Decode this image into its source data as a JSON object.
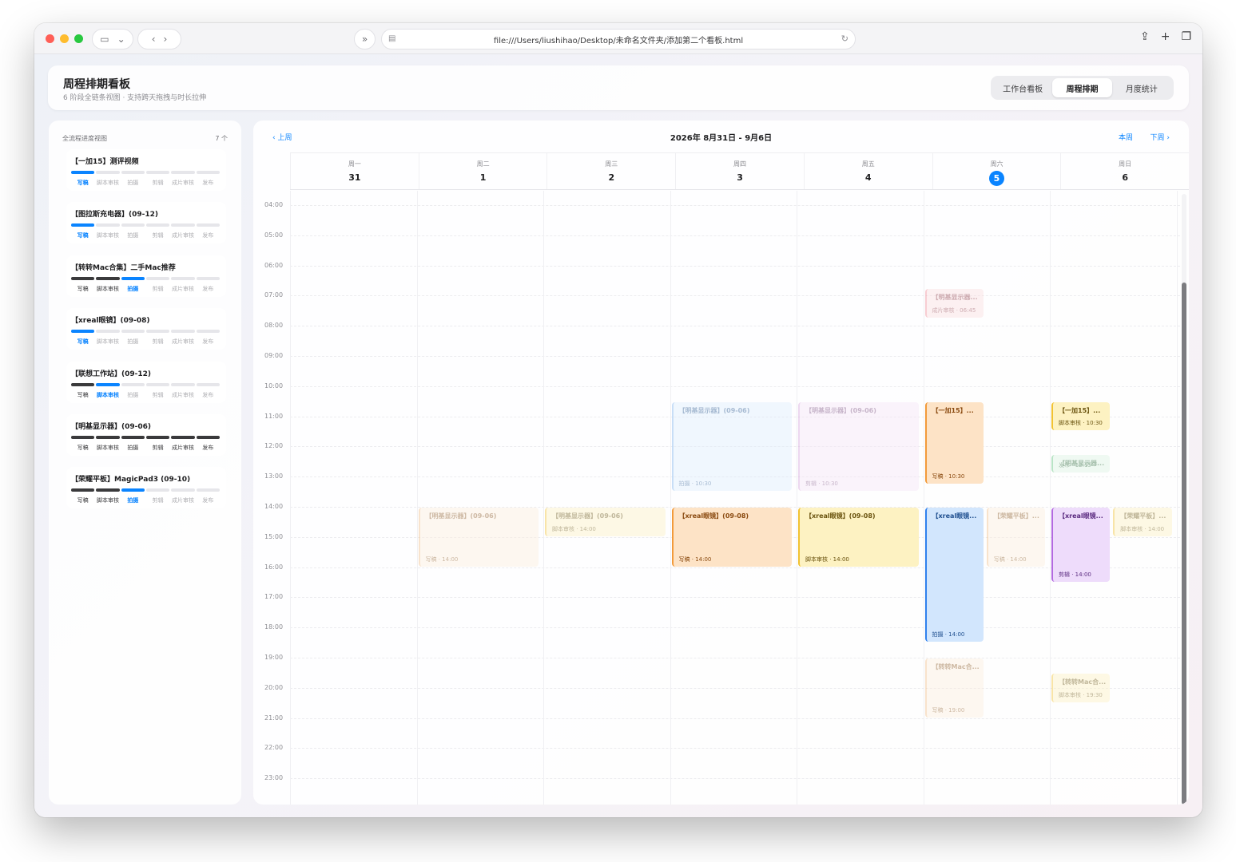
{
  "browser": {
    "url": "file:///Users/liushihao/Desktop/未命名文件夹/添加第二个看板.html",
    "icons": [
      "sidebar-toggle-icon",
      "chevron-down-icon",
      "back-icon",
      "forward-icon",
      "reader-icon",
      "page-icon",
      "reload-icon",
      "share-icon",
      "new-tab-icon",
      "tabs-overview-icon"
    ]
  },
  "header": {
    "title": "周程排期看板",
    "subtitle": "6 阶段全链条视图 · 支持跨天拖拽与时长拉伸",
    "tabs": [
      {
        "label": "工作台看板",
        "active": false
      },
      {
        "label": "周程排期",
        "active": true
      },
      {
        "label": "月度统计",
        "active": false
      }
    ]
  },
  "sidebar": {
    "title": "全流程进度视图",
    "count": "7 个",
    "stages": [
      "写稿",
      "脚本审核",
      "拍摄",
      "剪辑",
      "成片审核",
      "发布"
    ],
    "projects": [
      {
        "title": "【一加15】测评视频",
        "progress": [
          0,
          2,
          2,
          2,
          2,
          2
        ]
      },
      {
        "title": "【图拉斯充电器】(09-12)",
        "progress": [
          0,
          2,
          2,
          2,
          2,
          2
        ]
      },
      {
        "title": "【转转Mac合集】二手Mac推荐",
        "progress": [
          1,
          1,
          0,
          2,
          2,
          2
        ]
      },
      {
        "title": "【xreal眼镜】(09-08)",
        "progress": [
          0,
          2,
          2,
          2,
          2,
          2
        ]
      },
      {
        "title": "【联想工作站】(09-12)",
        "progress": [
          1,
          0,
          2,
          2,
          2,
          2
        ]
      },
      {
        "title": "【明基显示器】(09-06)",
        "progress": [
          1,
          1,
          1,
          1,
          1,
          1
        ]
      },
      {
        "title": "【荣耀平板】MagicPad3 (09-10)",
        "progress": [
          1,
          1,
          0,
          2,
          2,
          2
        ]
      }
    ]
  },
  "calendar": {
    "prev_label": "‹ 上周",
    "range": "2026年 8月31日 - 9月6日",
    "this_week": "本周",
    "next_label": "下周 ›",
    "days": [
      {
        "weekday": "周一",
        "date": "31",
        "today": false
      },
      {
        "weekday": "周二",
        "date": "1",
        "today": false
      },
      {
        "weekday": "周三",
        "date": "2",
        "today": false
      },
      {
        "weekday": "周四",
        "date": "3",
        "today": false
      },
      {
        "weekday": "周五",
        "date": "4",
        "today": false
      },
      {
        "weekday": "周六",
        "date": "5",
        "today": true
      },
      {
        "weekday": "周日",
        "date": "6",
        "today": false
      }
    ],
    "hours": [
      "04:00",
      "05:00",
      "06:00",
      "07:00",
      "08:00",
      "09:00",
      "10:00",
      "11:00",
      "12:00",
      "13:00",
      "14:00",
      "15:00",
      "16:00",
      "17:00",
      "18:00",
      "19:00",
      "20:00",
      "21:00",
      "22:00",
      "23:00"
    ],
    "events": [
      {
        "title": "【明基显示器】(09-06)",
        "meta": "写稿 · 14:00",
        "color": "c-peach",
        "faded": true
      },
      {
        "title": "【明基显示器】(09-06)",
        "meta": "脚本审核 · 14:00",
        "color": "c-yellow",
        "faded": true
      },
      {
        "title": "【明基显示器】(09-06)",
        "meta": "拍摄 · 10:30",
        "color": "c-lightblue",
        "faded": true
      },
      {
        "title": "【xreal眼镜】(09-08)",
        "meta": "写稿 · 14:00",
        "color": "c-orange",
        "faded": false
      },
      {
        "title": "【明基显示器】(09-06)",
        "meta": "剪辑 · 10:30",
        "color": "c-lavender",
        "faded": true
      },
      {
        "title": "【xreal眼镜】(09-08)",
        "meta": "脚本审核 · 14:00",
        "color": "c-yellow",
        "faded": false
      },
      {
        "title": "【明基显示器...",
        "meta": "成片审核 · 06:45",
        "color": "c-pink",
        "faded": true
      },
      {
        "title": "【一加15】...",
        "meta": "写稿 · 10:30",
        "color": "c-orange",
        "faded": false
      },
      {
        "title": "【xreal眼镜...",
        "meta": "拍摄 · 14:00",
        "color": "c-blue",
        "faded": false
      },
      {
        "title": "【荣耀平板】...",
        "meta": "写稿 · 14:00",
        "color": "c-peach",
        "faded": true
      },
      {
        "title": "【转转Mac合...",
        "meta": "写稿 · 19:00",
        "color": "c-peach",
        "faded": true
      },
      {
        "title": "【一加15】...",
        "meta": "脚本审核 · 10:30",
        "color": "c-yellow",
        "faded": false
      },
      {
        "title": "【明基显示器...",
        "meta": "发布 · 12:15",
        "color": "c-green",
        "faded": true
      },
      {
        "title": "【xreal眼镜...",
        "meta": "剪辑 · 14:00",
        "color": "c-purple",
        "faded": false
      },
      {
        "title": "【荣耀平板】...",
        "meta": "脚本审核 · 14:00",
        "color": "c-yellow",
        "faded": true
      },
      {
        "title": "【转转Mac合...",
        "meta": "脚本审核 · 19:30",
        "color": "c-yellow",
        "faded": true
      }
    ]
  }
}
